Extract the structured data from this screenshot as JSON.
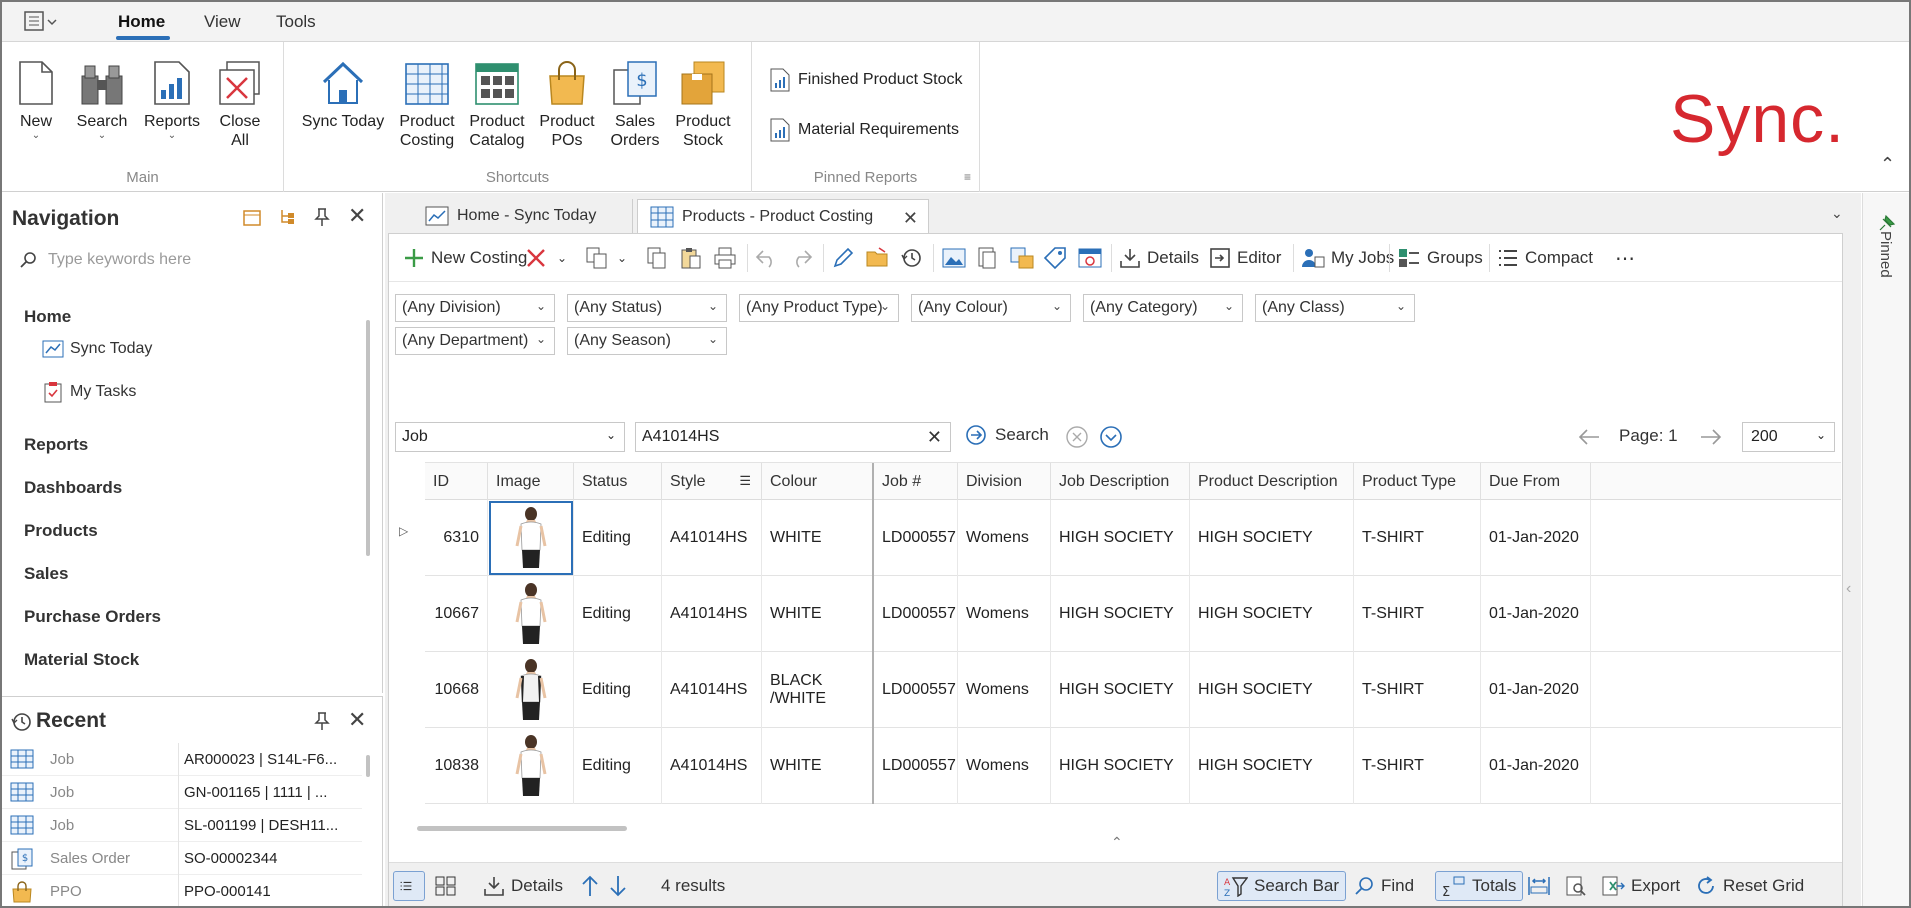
{
  "ribbon_tabs": [
    "Home",
    "View",
    "Tools"
  ],
  "ribbon": {
    "main": {
      "label": "Main",
      "buttons": [
        "New",
        "Search",
        "Reports",
        "Close All"
      ]
    },
    "shortcuts": {
      "label": "Shortcuts",
      "buttons": [
        "Sync Today",
        "Product Costing",
        "Product Catalog",
        "Product POs",
        "Sales Orders",
        "Product Stock"
      ]
    },
    "pinned": {
      "label": "Pinned Reports",
      "items": [
        "Finished Product Stock",
        "Material Requirements"
      ]
    },
    "logo": "Sync."
  },
  "navigation": {
    "title": "Navigation",
    "search_placeholder": "Type keywords here",
    "sections": [
      {
        "label": "Home",
        "children": [
          "Sync Today",
          "My Tasks"
        ]
      },
      {
        "label": "Reports"
      },
      {
        "label": "Dashboards"
      },
      {
        "label": "Products"
      },
      {
        "label": "Sales"
      },
      {
        "label": "Purchase Orders"
      },
      {
        "label": "Material Stock"
      }
    ]
  },
  "recent": {
    "title": "Recent",
    "items": [
      {
        "type": "Job",
        "value": "AR000023 | S14L-F6..."
      },
      {
        "type": "Job",
        "value": "GN-001165 | 1111 | ..."
      },
      {
        "type": "Job",
        "value": "SL-001199 | DESH11..."
      },
      {
        "type": "Sales Order",
        "value": "SO-00002344"
      },
      {
        "type": "PPO",
        "value": "PPO-000141"
      }
    ]
  },
  "doc_tabs": [
    {
      "label": "Home - Sync Today"
    },
    {
      "label": "Products - Product Costing"
    }
  ],
  "toolbar": {
    "new_costing": "New Costing",
    "details": "Details",
    "editor": "Editor",
    "my_jobs": "My Jobs",
    "groups": "Groups",
    "compact": "Compact"
  },
  "filters": [
    "(Any Division)",
    "(Any Status)",
    "(Any Product Type)",
    "(Any Colour)",
    "(Any Category)",
    "(Any Class)",
    "(Any Department)",
    "(Any Season)"
  ],
  "search": {
    "field": "Job",
    "value": "A41014HS",
    "button": "Search",
    "page_label": "Page: 1",
    "page_size": "200"
  },
  "grid": {
    "columns": [
      "ID",
      "Image",
      "Status",
      "Style",
      "Colour",
      "Job #",
      "Division",
      "Job Description",
      "Product Description",
      "Product Type",
      "Due From"
    ],
    "rows": [
      {
        "id": "6310",
        "status": "Editing",
        "style": "A41014HS",
        "colour": "WHITE",
        "job": "LD000557",
        "division": "Womens",
        "job_desc": "HIGH SOCIETY",
        "prod_desc": "HIGH SOCIETY",
        "prod_type": "T-SHIRT",
        "due": "01-Jan-2020"
      },
      {
        "id": "10667",
        "status": "Editing",
        "style": "A41014HS",
        "colour": "WHITE",
        "job": "LD000557",
        "division": "Womens",
        "job_desc": "HIGH SOCIETY",
        "prod_desc": "HIGH SOCIETY",
        "prod_type": "T-SHIRT",
        "due": "01-Jan-2020"
      },
      {
        "id": "10668",
        "status": "Editing",
        "style": "A41014HS",
        "colour": "BLACK /WHITE",
        "job": "LD000557",
        "division": "Womens",
        "job_desc": "HIGH SOCIETY",
        "prod_desc": "HIGH SOCIETY",
        "prod_type": "T-SHIRT",
        "due": "01-Jan-2020"
      },
      {
        "id": "10838",
        "status": "Editing",
        "style": "A41014HS",
        "colour": "WHITE",
        "job": "LD000557",
        "division": "Womens",
        "job_desc": "HIGH SOCIETY",
        "prod_desc": "HIGH SOCIETY",
        "prod_type": "T-SHIRT",
        "due": "01-Jan-2020"
      }
    ]
  },
  "bottombar": {
    "details": "Details",
    "results": "4 results",
    "search_bar": "Search Bar",
    "find": "Find",
    "totals": "Totals",
    "export": "Export",
    "reset_grid": "Reset Grid"
  },
  "pinned_strip": "Pinned",
  "colors": {
    "accent": "#2b6fb7",
    "logo": "#d6282f",
    "delete": "#d9363e",
    "new": "#3a9b46"
  }
}
